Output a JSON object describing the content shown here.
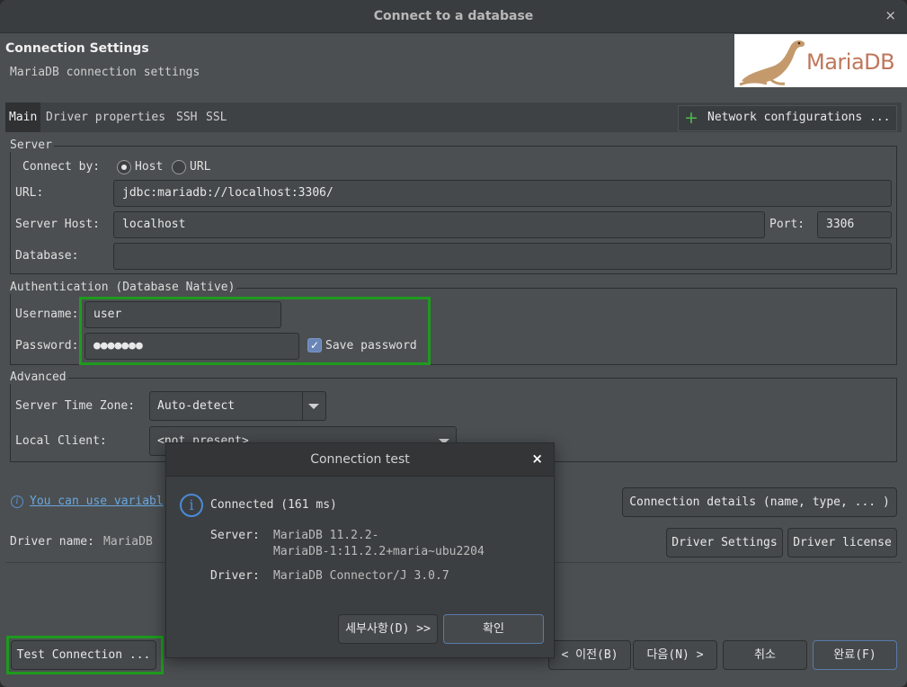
{
  "window": {
    "title": "Connect to a database",
    "close_glyph": "×"
  },
  "header": {
    "title": "Connection Settings",
    "subtitle": "MariaDB connection settings",
    "logo_text": "MariaDB"
  },
  "tabs": {
    "items": [
      "Main",
      "Driver properties",
      "SSH",
      "SSL"
    ],
    "active": "Main",
    "network_button": "Network configurations ..."
  },
  "server": {
    "group_title": "Server",
    "connect_by_label": "Connect by:",
    "host_option": "Host",
    "url_option": "URL",
    "connect_by_selected": "Host",
    "url_label": "URL:",
    "url_value": "jdbc:mariadb://localhost:3306/",
    "host_label": "Server Host:",
    "host_value": "localhost",
    "port_label": "Port:",
    "port_value": "3306",
    "database_label": "Database:",
    "database_value": ""
  },
  "auth": {
    "group_title": "Authentication (Database Native)",
    "username_label": "Username:",
    "username_value": "user",
    "password_label": "Password:",
    "password_value": "●●●●●●●",
    "save_password_label": "Save password",
    "save_password_checked": true
  },
  "advanced": {
    "group_title": "Advanced",
    "timezone_label": "Server Time Zone:",
    "timezone_value": "Auto-detect",
    "local_client_label": "Local Client:",
    "local_client_value": "<not present>"
  },
  "footer": {
    "variables_link": "You can use variabl",
    "connection_details_button": "Connection details (name, type, ... )",
    "driver_name_label": "Driver name:",
    "driver_name_value": "MariaDB",
    "driver_settings_button": "Driver Settings",
    "driver_license_button": "Driver license"
  },
  "bottom_buttons": {
    "test_connection": "Test Connection ...",
    "back": "< 이전(B)",
    "next": "다음(N) >",
    "cancel": "취소",
    "finish": "완료(F)"
  },
  "dialog": {
    "title": "Connection test",
    "close_glyph": "×",
    "status": "Connected (161 ms)",
    "server_label": "Server:",
    "server_line1": "MariaDB 11.2.2-",
    "server_line2": "MariaDB-1:11.2.2+maria~ubu2204",
    "driver_label": "Driver:",
    "driver_value": "MariaDB Connector/J 3.0.7",
    "details_button": "세부사항(D) >>",
    "ok_button": "확인"
  },
  "colors": {
    "highlight_border": "#1e9a1e",
    "link": "#6aa7e0",
    "info": "#4a8ad8",
    "background": "#4b4f51"
  }
}
